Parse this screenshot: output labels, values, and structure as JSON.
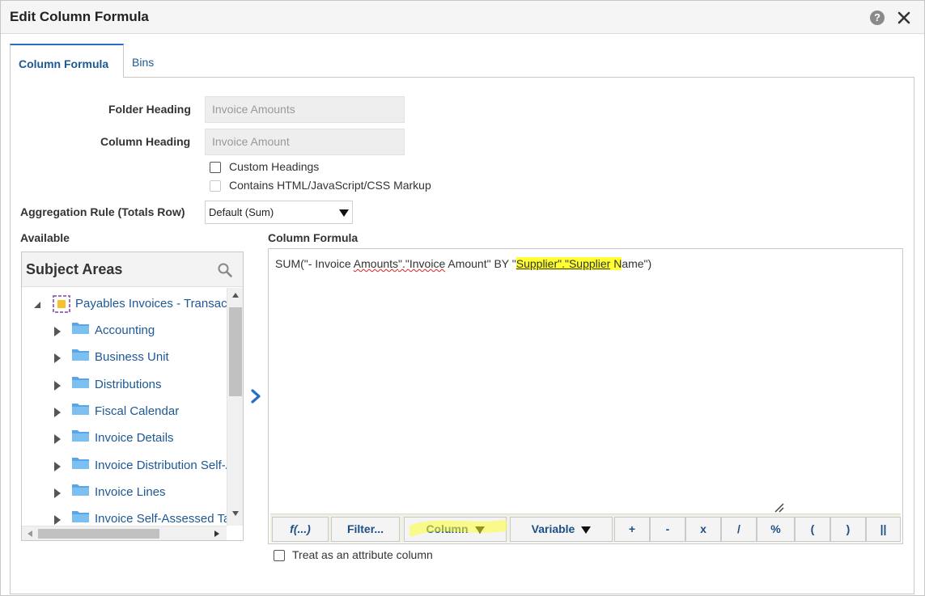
{
  "dialog": {
    "title": "Edit Column Formula",
    "help_symbol": "?"
  },
  "tabs": [
    {
      "label": "Column Formula",
      "active": true
    },
    {
      "label": "Bins",
      "active": false
    }
  ],
  "form": {
    "folder_heading_label": "Folder Heading",
    "folder_heading_value": "Invoice Amounts",
    "column_heading_label": "Column Heading",
    "column_heading_value": "Invoice Amount",
    "custom_headings_label": "Custom Headings",
    "custom_headings_checked": false,
    "html_markup_label": "Contains HTML/JavaScript/CSS Markup",
    "html_markup_checked": false,
    "html_markup_disabled": true,
    "aggregation_label": "Aggregation Rule (Totals Row)",
    "aggregation_value": "Default (Sum)"
  },
  "available": {
    "section_label": "Available",
    "panel_title": "Subject Areas",
    "root": "Payables Invoices - Transactional",
    "items": [
      "Accounting",
      "Business Unit",
      "Distributions",
      "Fiscal Calendar",
      "Invoice Details",
      "Invoice Distribution Self-Assessed",
      "Invoice Lines",
      "Invoice Self-Assessed Tax"
    ]
  },
  "formula": {
    "section_label": "Column Formula",
    "parts": {
      "p1": "SUM(\"- Invoice ",
      "p2": "Amounts",
      "p3": "\".\"",
      "p4": "Invoice",
      "p5": " Amount\" BY \"",
      "p6": "Supplier\".\"Supplier",
      "p7": " N",
      "p8": "ame\")"
    },
    "buttons": {
      "fx": "f(...)",
      "filter": "Filter...",
      "column": "Column",
      "variable": "Variable",
      "plus": "+",
      "minus": "-",
      "times": "x",
      "divide": "/",
      "percent": "%",
      "lparen": "(",
      "rparen": ")",
      "concat": "||"
    },
    "treat_attribute_label": "Treat as an attribute column",
    "treat_attribute_checked": false
  },
  "colors": {
    "link_blue": "#1d5894",
    "highlight_yellow": "#ffff33",
    "folder_blue": "#5aa5e6"
  }
}
